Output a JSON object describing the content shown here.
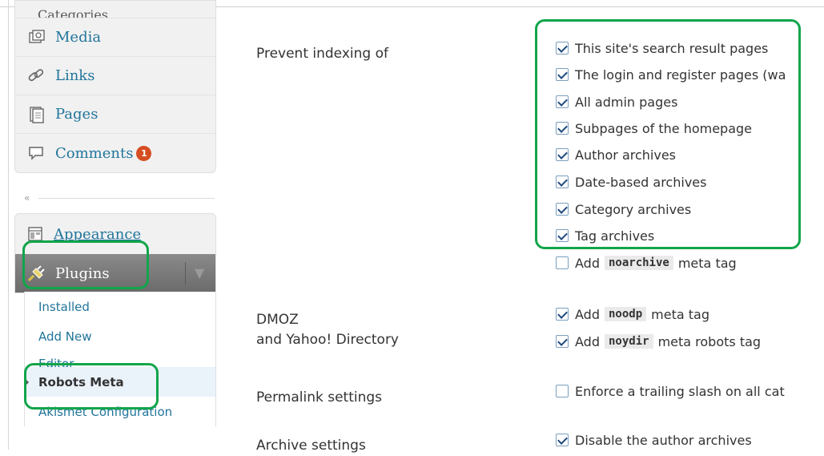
{
  "sidebar": {
    "partial_top": "Categories",
    "items": [
      {
        "label": "Media",
        "icon": "media-icon"
      },
      {
        "label": "Links",
        "icon": "links-icon"
      },
      {
        "label": "Pages",
        "icon": "pages-icon"
      },
      {
        "label": "Comments",
        "icon": "comments-icon",
        "badge": "1"
      }
    ],
    "collapse": "«",
    "appearance": "Appearance",
    "plugins": "Plugins",
    "plugins_toggle": "▼",
    "submenu": [
      {
        "label": "Installed"
      },
      {
        "label": "Add New"
      },
      {
        "label": "Editor"
      },
      {
        "label": "Robots Meta",
        "current": true
      },
      {
        "label": "Akismet Configuration"
      }
    ]
  },
  "form": {
    "prevent_indexing": {
      "label": "Prevent indexing of",
      "options": [
        {
          "text": "This site's search result pages",
          "checked": true
        },
        {
          "text": "The login and register pages (wa",
          "checked": true
        },
        {
          "text": "All admin pages",
          "checked": true
        },
        {
          "text": "Subpages of the homepage",
          "checked": true
        },
        {
          "text": "Author archives",
          "checked": true
        },
        {
          "text": "Date-based archives",
          "checked": true
        },
        {
          "text": "Category archives",
          "checked": true
        },
        {
          "text": "Tag archives",
          "checked": true
        }
      ],
      "noarchive": {
        "prefix": "Add",
        "code": "noarchive",
        "suffix": "meta tag",
        "checked": false
      }
    },
    "dmoz": {
      "label_line1": "DMOZ",
      "label_line2": "and Yahoo! Directory",
      "noodp": {
        "prefix": "Add",
        "code": "noodp",
        "suffix": "meta tag",
        "checked": true
      },
      "noydir": {
        "prefix": "Add",
        "code": "noydir",
        "suffix": "meta robots tag",
        "checked": true
      }
    },
    "permalink": {
      "label": "Permalink settings",
      "option": "Enforce a trailing slash on all cat",
      "checked": false
    },
    "archive": {
      "label": "Archive settings",
      "option": "Disable the author archives",
      "checked": true
    }
  },
  "colors": {
    "highlight": "#11a54a",
    "link": "#21759b",
    "badge": "#d54e21"
  }
}
